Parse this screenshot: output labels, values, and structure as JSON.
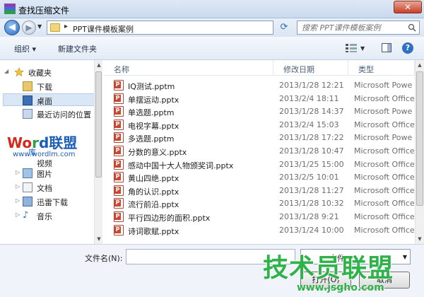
{
  "window": {
    "title": "查找压缩文件",
    "close_glyph": "✕"
  },
  "address": {
    "separator": "▸",
    "path": "PPT课件模板案例",
    "search_placeholder": "搜索 PPT课件模板案例"
  },
  "toolbar": {
    "organize": "组织 ▾",
    "new_folder": "新建文件夹",
    "help": "?"
  },
  "nav": {
    "favorites": "收藏夹",
    "downloads": "下载",
    "desktop": "桌面",
    "recent": "最近访问的位置",
    "libraries_partial": "库",
    "videos_partial": "视频",
    "pictures": "图片",
    "documents": "文档",
    "thunder": "迅雷下载",
    "music": "音乐"
  },
  "columns": {
    "name": "名称",
    "date": "修改日期",
    "type": "类型"
  },
  "files": [
    {
      "name": "IQ测试.pptm",
      "date": "2013/1/28 12:21",
      "type": "Microsoft Powe"
    },
    {
      "name": "单摆运动.pptx",
      "date": "2013/2/4 18:11",
      "type": "Microsoft Office"
    },
    {
      "name": "单选题.pptm",
      "date": "2013/1/28 14:37",
      "type": "Microsoft Powe"
    },
    {
      "name": "电视字幕.pptx",
      "date": "2013/2/4 15:03",
      "type": "Microsoft Office"
    },
    {
      "name": "多选题.pptm",
      "date": "2013/1/28 17:22",
      "type": "Microsoft Powe"
    },
    {
      "name": "分数的意义.pptx",
      "date": "2013/1/28 10:47",
      "type": "Microsoft Office"
    },
    {
      "name": "感动中国十大人物颁奖词.pptx",
      "date": "2013/1/25 15:00",
      "type": "Microsoft Office"
    },
    {
      "name": "黄山四绝.pptx",
      "date": "2013/2/5 10:01",
      "type": "Microsoft Office"
    },
    {
      "name": "角的认识.pptx",
      "date": "2013/1/28 11:27",
      "type": "Microsoft Office"
    },
    {
      "name": "流行前沿.pptx",
      "date": "2013/1/28 10:32",
      "type": "Microsoft Office"
    },
    {
      "name": "平行四边形的面积.pptx",
      "date": "2013/1/28 9:21",
      "type": "Microsoft Office"
    },
    {
      "name": "诗词歌赋.pptx",
      "date": "2013/1/24 10:00",
      "type": "Microsoft Office"
    }
  ],
  "bottom": {
    "filename_label": "文件名(N):",
    "filetype_partial": "文件",
    "open": "打开(O)",
    "cancel": "取消"
  },
  "watermarks": {
    "word_w": "Wo",
    "word_r": "r",
    "word_d": "d联盟",
    "word_url": "www.wordlm.com",
    "jsgho": "技术员联盟",
    "jsgho_url": "www.jsgho.com"
  }
}
